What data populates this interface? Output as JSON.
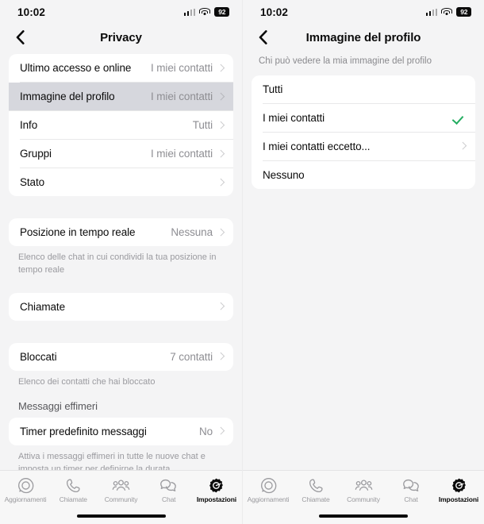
{
  "status_bar": {
    "time": "10:02",
    "battery": "92",
    "signal_icon": "cellular-signal-icon",
    "wifi_icon": "wifi-icon",
    "battery_icon": "battery-icon"
  },
  "left_panel": {
    "back_icon": "back-chevron-icon",
    "title": "Privacy",
    "group_visibility": [
      {
        "label": "Ultimo accesso e online",
        "value": "I miei contatti",
        "selected": false
      },
      {
        "label": "Immagine del profilo",
        "value": "I miei contatti",
        "selected": true
      },
      {
        "label": "Info",
        "value": "Tutti",
        "selected": false
      },
      {
        "label": "Gruppi",
        "value": "I miei contatti",
        "selected": false
      },
      {
        "label": "Stato",
        "value": "",
        "selected": false
      }
    ],
    "group_location": [
      {
        "label": "Posizione in tempo reale",
        "value": "Nessuna"
      }
    ],
    "location_footnote": "Elenco delle chat in cui condividi la tua posizione in tempo reale",
    "group_calls": [
      {
        "label": "Chiamate",
        "value": ""
      }
    ],
    "group_blocked": [
      {
        "label": "Bloccati",
        "value": "7 contatti"
      }
    ],
    "blocked_footnote": "Elenco dei contatti che hai bloccato",
    "ephemeral_header": "Messaggi effimeri",
    "group_ephemeral": [
      {
        "label": "Timer predefinito messaggi",
        "value": "No"
      }
    ],
    "ephemeral_footnote": "Attiva i messaggi effimeri in tutte le nuove chat e imposta un timer per definirne la durata"
  },
  "right_panel": {
    "back_icon": "back-chevron-icon",
    "title": "Immagine del profilo",
    "subtitle": "Chi può vedere la mia immagine del profilo",
    "options": [
      {
        "label": "Tutti",
        "checked": false,
        "chevron": false
      },
      {
        "label": "I miei contatti",
        "checked": true,
        "chevron": false
      },
      {
        "label": "I miei contatti eccetto...",
        "checked": false,
        "chevron": true
      },
      {
        "label": "Nessuno",
        "checked": false,
        "chevron": false
      }
    ]
  },
  "tab_bar": {
    "tabs": [
      {
        "label": "Aggiornamenti",
        "icon": "status-updates-icon",
        "active": false
      },
      {
        "label": "Chiamate",
        "icon": "phone-icon",
        "active": false
      },
      {
        "label": "Community",
        "icon": "community-people-icon",
        "active": false
      },
      {
        "label": "Chat",
        "icon": "chat-bubbles-icon",
        "active": false
      },
      {
        "label": "Impostazioni",
        "icon": "gear-icon",
        "active": true
      }
    ]
  },
  "colors": {
    "accent_green": "#24ad61",
    "selected_row": "#d6d7dd",
    "background": "#f4f4f5",
    "card": "#ffffff"
  }
}
